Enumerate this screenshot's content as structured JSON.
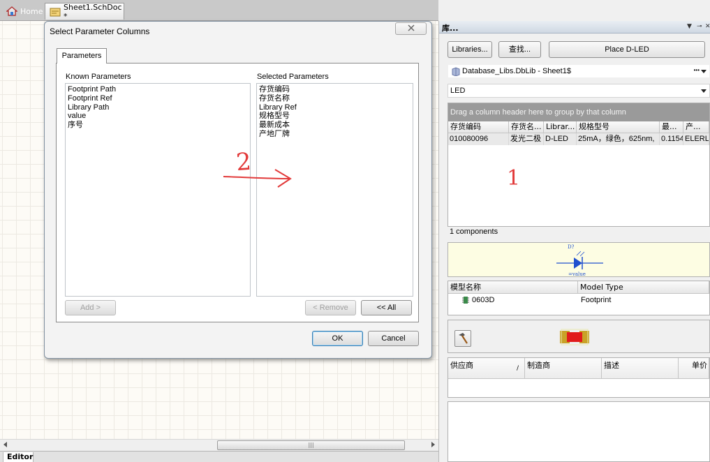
{
  "doc_tabs": {
    "home_label": "Home",
    "sheet_label": "Sheet1.SchDoc *"
  },
  "editor_tab_label": "Editor",
  "dialog": {
    "title": "Select Parameter Columns",
    "tab_label": "Parameters",
    "known_label": "Known Parameters",
    "known_items": [
      "Footprint Path",
      "Footprint Ref",
      "Library Path",
      "value",
      "序号"
    ],
    "selected_label": "Selected Parameters",
    "selected_items": [
      "存货编码",
      "存货名称",
      "Library Ref",
      "规格型号",
      "最新成本",
      "产地厂牌"
    ],
    "add_label": "Add >",
    "remove_label": "< Remove",
    "all_label": "<< All",
    "ok_label": "OK",
    "cancel_label": "Cancel"
  },
  "annotations": {
    "mark_2": "2",
    "mark_1": "1",
    "color": "#e23a3a"
  },
  "library_panel": {
    "title": "库...",
    "libraries_button": "Libraries...",
    "search_button": "查找...",
    "place_button": "Place D-LED",
    "library_combo": "Database_Libs.DbLib - Sheet1$",
    "filter_combo": "LED",
    "group_hint": "Drag a column header here to group by that column",
    "columns": [
      "存货编码",
      "存货名...",
      "Librar...",
      "规格型号",
      "最...",
      "产..."
    ],
    "row": [
      "010080096",
      "发光二极",
      "D-LED",
      "25mA，绿色，625nm,",
      "0.1154",
      "ELERLI"
    ],
    "component_count": "1 components",
    "symbol": {
      "designator": "D?",
      "comment": "=value"
    },
    "model_columns": [
      "模型名称",
      "Model Type"
    ],
    "model_row": {
      "name": "0603D",
      "type": "Footprint"
    },
    "supplier_columns": [
      "供应商",
      "制造商",
      "描述",
      "单价"
    ]
  },
  "colors": {
    "diode_blue": "#1f4fcf",
    "pad_gold": "#c9a227",
    "pad_red": "#e11b1b"
  }
}
